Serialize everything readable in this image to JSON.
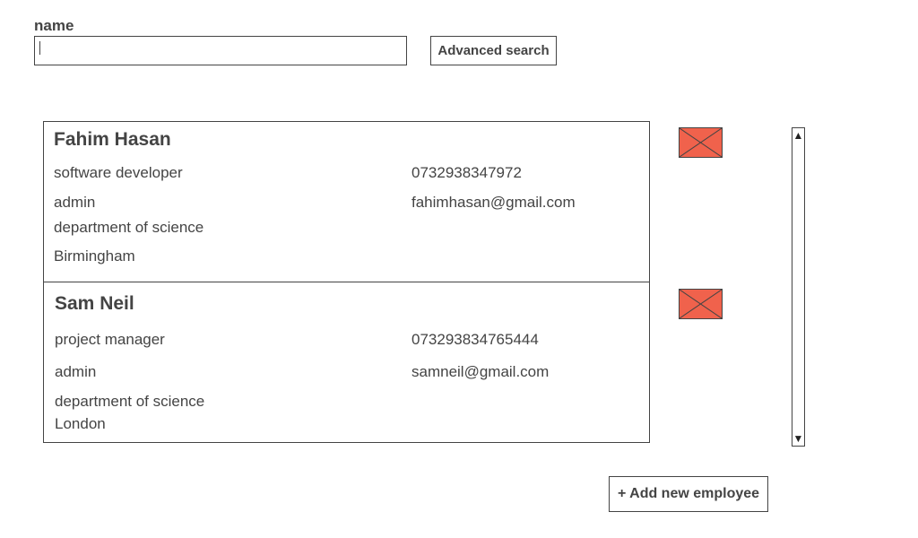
{
  "search": {
    "label": "name",
    "value": "",
    "advanced_label": "Advanced search"
  },
  "employees": [
    {
      "name": "Fahim Hasan",
      "role": "software developer",
      "phone": "0732938347972",
      "access": "admin",
      "email": "fahimhasan@gmail.com",
      "department": "department of science",
      "city": "Birmingham"
    },
    {
      "name": "Sam Neil",
      "role": "project manager",
      "phone": "073293834765444",
      "access": "admin",
      "email": "samneil@gmail.com",
      "department": "department of science",
      "city": "London"
    }
  ],
  "icons": {
    "mail": "envelope-icon",
    "scroll_up": "scroll-up-arrow-icon",
    "scroll_down": "scroll-down-arrow-icon"
  },
  "colors": {
    "envelope": "#f0624c",
    "border": "#444444"
  },
  "actions": {
    "add_label": "+ Add new employee"
  }
}
